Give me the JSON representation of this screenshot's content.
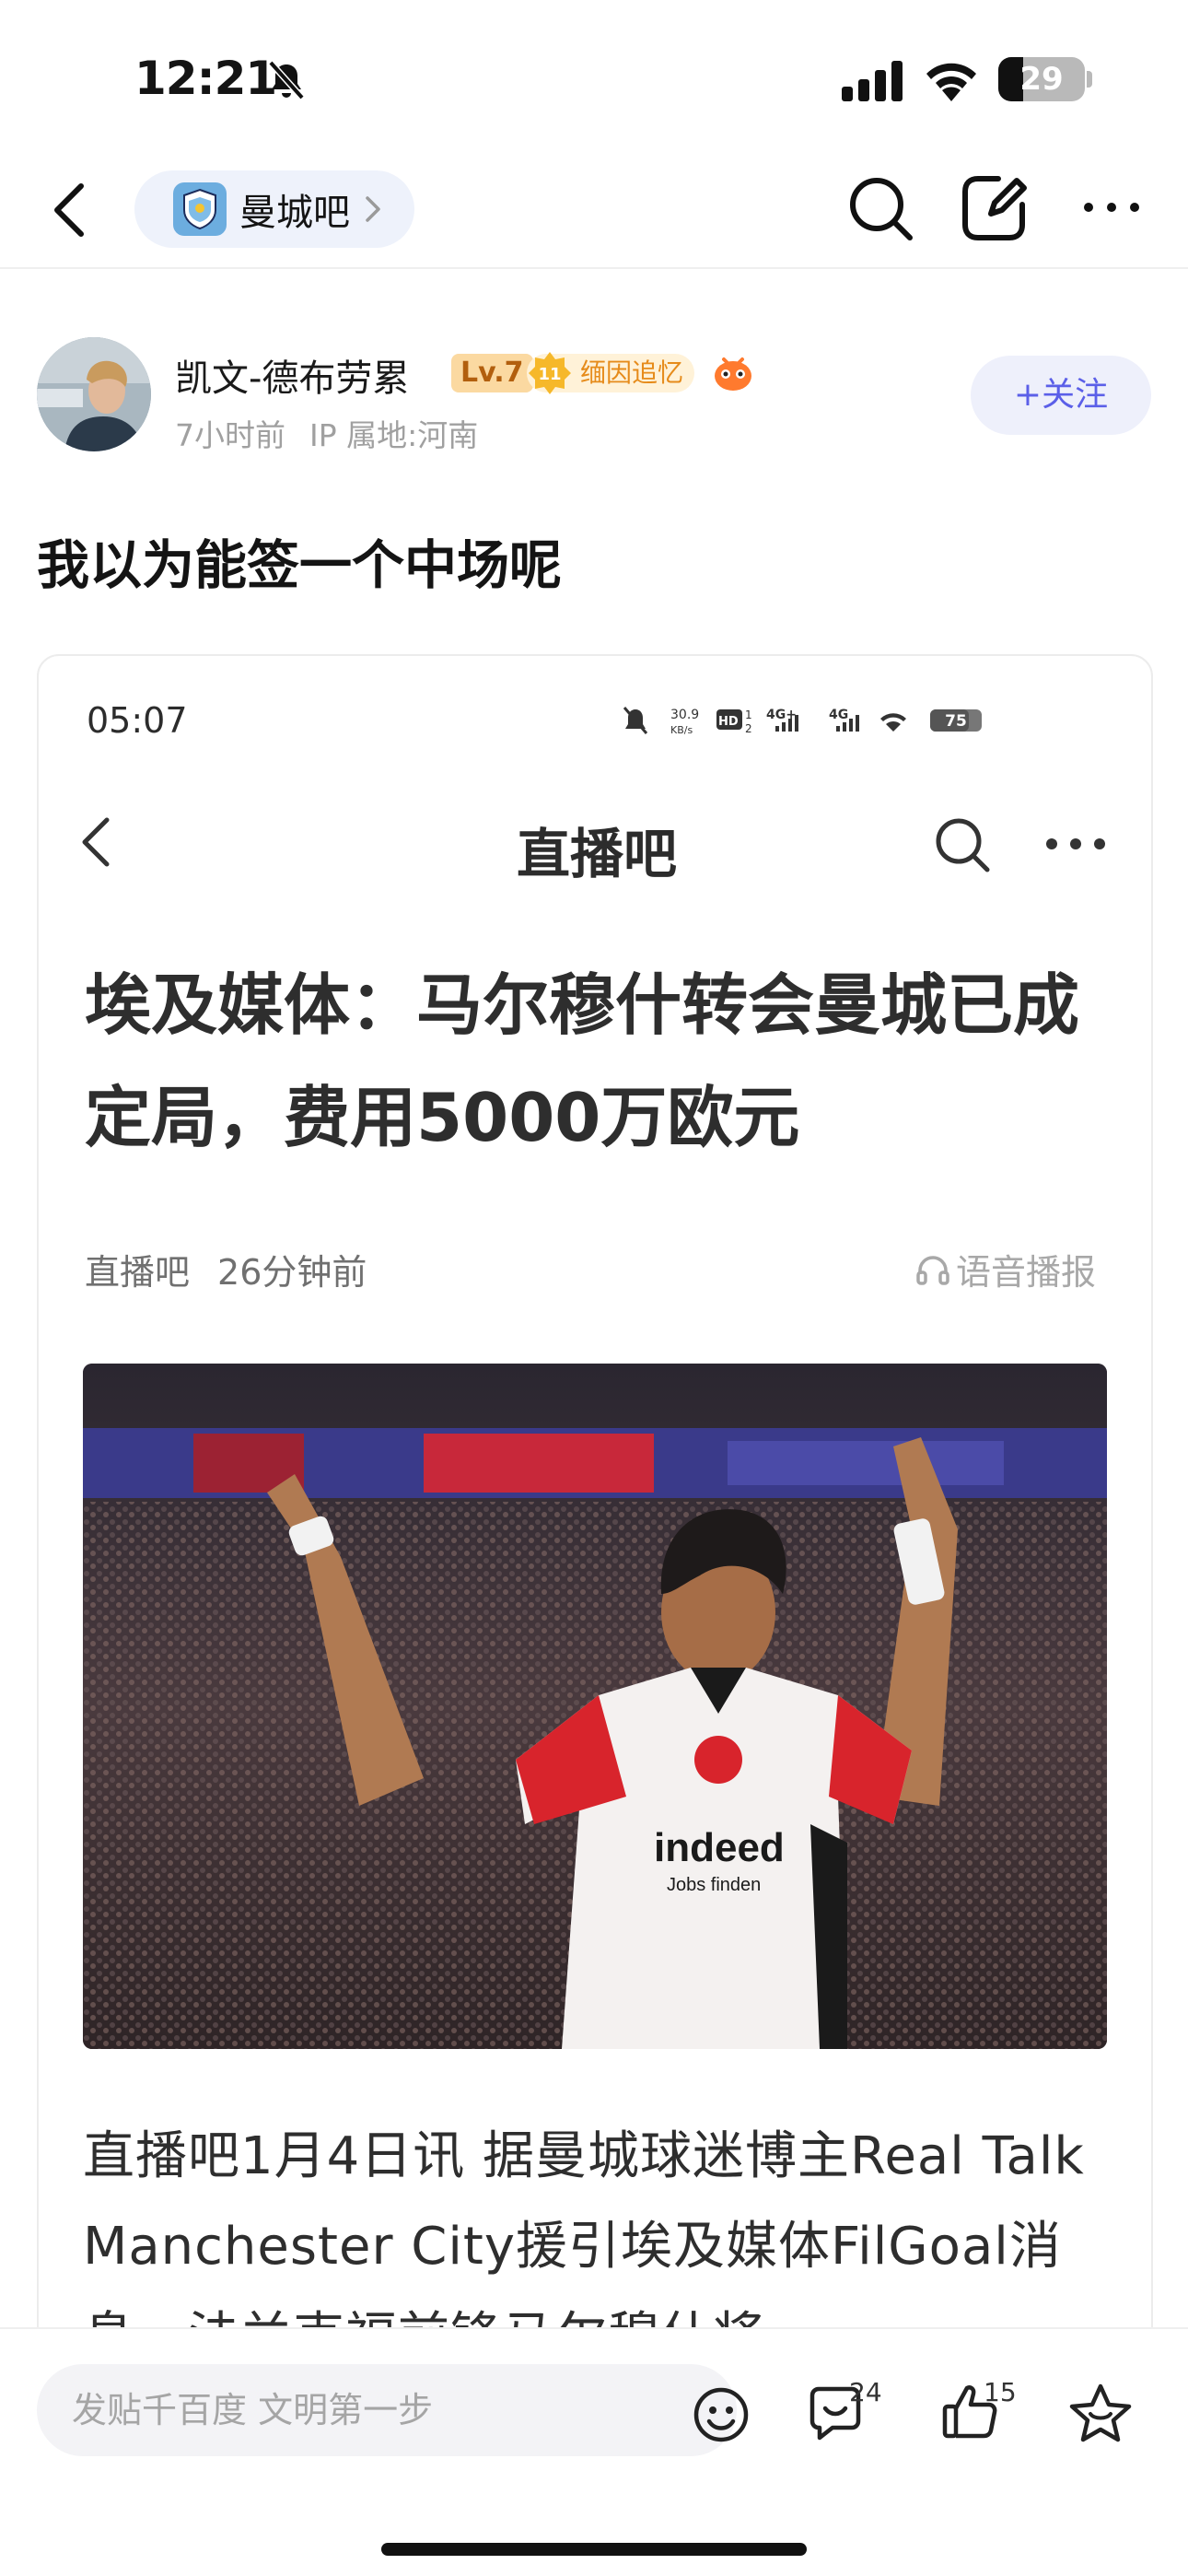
{
  "status_bar": {
    "time": "12:21",
    "battery": "29",
    "battery_level": 0.29
  },
  "nav": {
    "forum_name": "曼城吧"
  },
  "post": {
    "author": "凯文-德布劳累",
    "level": "Lv.7",
    "fan_badge": "缅因追忆",
    "fan_level": "11",
    "time_ago": "7小时前",
    "ip_location": "IP 属地:河南",
    "follow_label": "+关注",
    "title": "我以为能签一个中场呢"
  },
  "embed": {
    "time": "05:07",
    "net_speed_top": "30.9",
    "net_speed_bottom": "KB/s",
    "battery": "75",
    "app_title": "直播吧",
    "headline": "埃及媒体：马尔穆什转会曼城已成定局，费用5000万欧元",
    "source": "直播吧",
    "time_ago": "26分钟前",
    "voice_label": "语音播报",
    "photo_sponsor": "indeed",
    "photo_sponsor_sub": "Jobs finden",
    "body": "直播吧1月4日讯 据曼城球迷博主Real Talk Manchester City援引埃及媒体FilGoal消息，法兰克福前锋马尔穆什将"
  },
  "bottom_bar": {
    "input_placeholder": "发贴千百度 文明第一步",
    "reply_count": "24",
    "like_count": "15"
  },
  "colors": {
    "accent": "#5b5fe8",
    "follow_bg": "#eef0fb",
    "pill_bg": "#eef2fb",
    "level_bg": "#fbd9a1",
    "fan_bg": "#fff2d8"
  }
}
